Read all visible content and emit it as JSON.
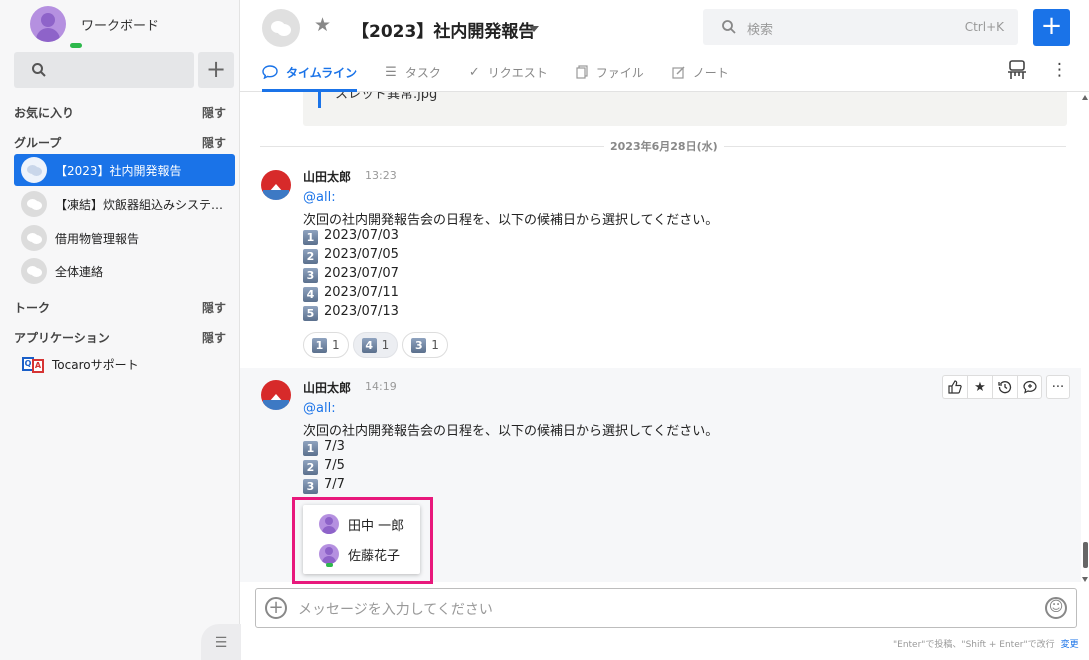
{
  "workspace": {
    "name": "ワークボード"
  },
  "sidebar": {
    "search_placeholder": "",
    "add_label": "+",
    "favorites": {
      "title": "お気に入り",
      "hide": "隠す"
    },
    "groups": {
      "title": "グループ",
      "hide": "隠す",
      "items": [
        {
          "label": "【2023】社内開発報告",
          "active": true
        },
        {
          "label": "【凍結】炊飯器組込みシステ…",
          "active": false
        },
        {
          "label": "借用物管理報告",
          "active": false
        },
        {
          "label": "全体連絡",
          "active": false
        }
      ]
    },
    "talk": {
      "title": "トーク",
      "hide": "隠す"
    },
    "apps": {
      "title": "アプリケーション",
      "hide": "隠す",
      "items": [
        {
          "label": "Tocaroサポート"
        }
      ]
    },
    "bottom_icon": "list-icon"
  },
  "header": {
    "title": "【2023】社内開発報告",
    "search": {
      "placeholder": "検索",
      "shortcut": "Ctrl+K"
    },
    "new_label": "+",
    "tabs": [
      {
        "label": "タイムライン",
        "icon": "chat-icon",
        "active": true
      },
      {
        "label": "タスク",
        "icon": "list-icon",
        "active": false
      },
      {
        "label": "リクエスト",
        "icon": "check-icon",
        "active": false
      },
      {
        "label": "ファイル",
        "icon": "file-icon",
        "active": false
      },
      {
        "label": "ノート",
        "icon": "note-icon",
        "active": false
      }
    ]
  },
  "timeline": {
    "attachment": {
      "filename": "スレッド異常.jpg"
    },
    "date_separator": "2023年6月28日(水)",
    "messages": [
      {
        "author": "山田太郎",
        "time": "13:23",
        "mention": "@all:",
        "text": "次回の社内開発報告会の日程を、以下の候補日から選択してください。",
        "options": [
          {
            "num": "1",
            "text": "2023/07/03"
          },
          {
            "num": "2",
            "text": "2023/07/05"
          },
          {
            "num": "3",
            "text": "2023/07/07"
          },
          {
            "num": "4",
            "text": "2023/07/11"
          },
          {
            "num": "5",
            "text": "2023/07/13"
          }
        ],
        "reactions": [
          {
            "emoji": "1",
            "count": "1",
            "selected": false
          },
          {
            "emoji": "4",
            "count": "1",
            "selected": true
          },
          {
            "emoji": "3",
            "count": "1",
            "selected": false
          }
        ]
      },
      {
        "author": "山田太郎",
        "time": "14:19",
        "mention": "@all:",
        "text": "次回の社内開発報告会の日程を、以下の候補日から選択してください。",
        "options": [
          {
            "num": "1",
            "text": "7/3"
          },
          {
            "num": "2",
            "text": "7/5"
          },
          {
            "num": "3",
            "text": "7/7"
          }
        ]
      }
    ],
    "reactor_popup": [
      {
        "name": "田中 一郎",
        "online": false
      },
      {
        "name": "佐藤花子",
        "online": true
      }
    ]
  },
  "composer": {
    "placeholder": "メッセージを入力してください",
    "hint": "\"Enter\"で投稿、\"Shift + Enter\"で改行",
    "change": "変更"
  },
  "colors": {
    "accent": "#1a73e8",
    "highlight": "#e8187c",
    "online": "#2db84b"
  }
}
